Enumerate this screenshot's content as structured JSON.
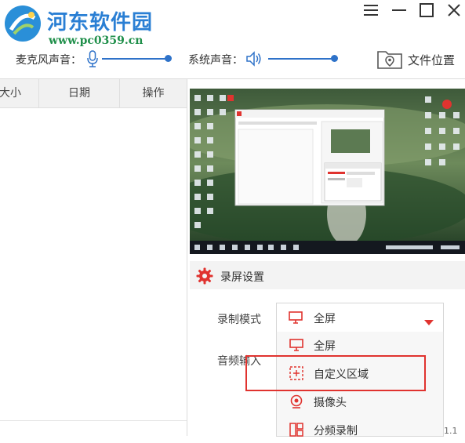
{
  "watermark": {
    "site_name": "河东软件园",
    "url": "www.pc0359.cn"
  },
  "window_controls": {
    "menu": "menu-icon",
    "minimize": "minimize-icon",
    "maximize": "maximize-icon",
    "close": "close-icon"
  },
  "toolbar": {
    "mic_label": "麦克风声音：",
    "mic_level": 0.95,
    "system_label": "系统声音：",
    "system_level": 0.95,
    "folder_label": "文件位置",
    "accent": "#2e72c9"
  },
  "list": {
    "columns": [
      "大小",
      "日期",
      "操作"
    ]
  },
  "preview": {
    "icon": "desktop-preview"
  },
  "settings": {
    "section_title": "录屏设置",
    "mode_label": "录制模式",
    "mode_value": "全屏",
    "audio_label": "音频输入",
    "brand_color": "#e0332f"
  },
  "mode_menu": {
    "items": [
      {
        "label": "全屏",
        "icon": "monitor-icon"
      },
      {
        "label": "自定义区域",
        "icon": "custom-area-icon"
      },
      {
        "label": "摄像头",
        "icon": "camera-icon"
      },
      {
        "label": "分频录制",
        "icon": "split-icon"
      }
    ],
    "highlighted_index": 1
  },
  "version_fragment": "1.1"
}
